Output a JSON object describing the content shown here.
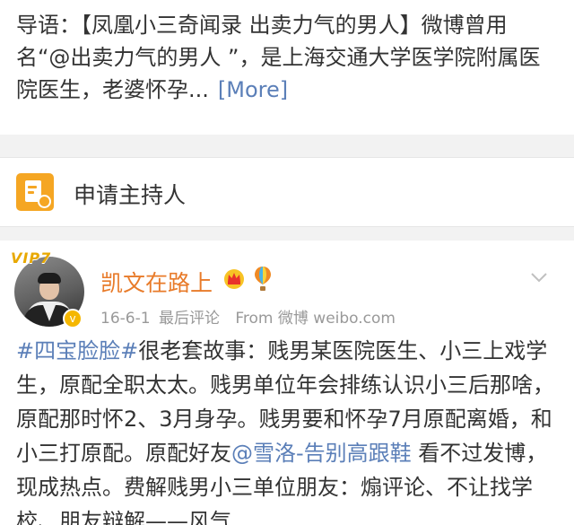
{
  "intro": {
    "text": "导语：【凤凰小三奇闻录 出卖力气的男人】微博曾用名“@出卖力气的男人 ”，是上海交通大学医学院附属医院医生，老婆怀孕...",
    "more_label": "[More]"
  },
  "host": {
    "icon": "apply-host-icon",
    "label": "申请主持人"
  },
  "post": {
    "vip_label": "VIP7",
    "username": "凯文在路上",
    "date": "16-6-1",
    "last_comment": "最后评论",
    "source": "From 微博 weibo.com",
    "body": {
      "topic": "#四宝脸脸#",
      "part1": "很老套故事：贱男某医院医生、小三上戏学生，原配全职太太。贱男单位年会排练认识小三后那啥，原配那时怀2、3月身孕。贱男要和怀孕7月原配离婚，和小三打原配。原配好友",
      "mention": "@雪洛-告别高跟鞋",
      "part2": " 看不过发博，现成热点。费解贱男小三单位朋友：煽评论、不让找学校、朋友辩解——风气"
    }
  },
  "colors": {
    "accent_orange": "#f5a623",
    "username_orange": "#e87b2a",
    "link_blue": "#5b7fb8"
  }
}
